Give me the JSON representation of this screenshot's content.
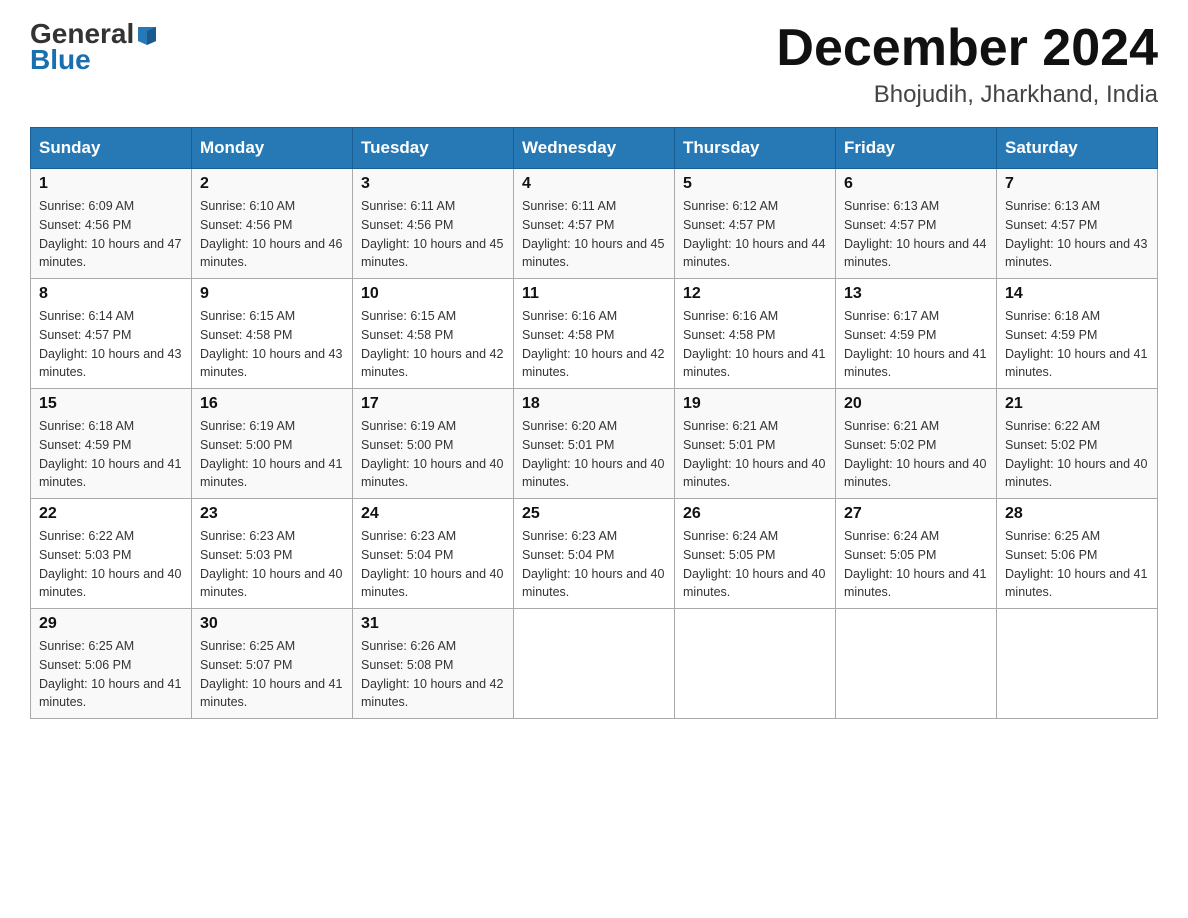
{
  "header": {
    "logo_general": "General",
    "logo_blue": "Blue",
    "month_title": "December 2024",
    "location": "Bhojudih, Jharkhand, India"
  },
  "days_of_week": [
    "Sunday",
    "Monday",
    "Tuesday",
    "Wednesday",
    "Thursday",
    "Friday",
    "Saturday"
  ],
  "weeks": [
    [
      {
        "day": "1",
        "sunrise": "6:09 AM",
        "sunset": "4:56 PM",
        "daylight": "10 hours and 47 minutes."
      },
      {
        "day": "2",
        "sunrise": "6:10 AM",
        "sunset": "4:56 PM",
        "daylight": "10 hours and 46 minutes."
      },
      {
        "day": "3",
        "sunrise": "6:11 AM",
        "sunset": "4:56 PM",
        "daylight": "10 hours and 45 minutes."
      },
      {
        "day": "4",
        "sunrise": "6:11 AM",
        "sunset": "4:57 PM",
        "daylight": "10 hours and 45 minutes."
      },
      {
        "day": "5",
        "sunrise": "6:12 AM",
        "sunset": "4:57 PM",
        "daylight": "10 hours and 44 minutes."
      },
      {
        "day": "6",
        "sunrise": "6:13 AM",
        "sunset": "4:57 PM",
        "daylight": "10 hours and 44 minutes."
      },
      {
        "day": "7",
        "sunrise": "6:13 AM",
        "sunset": "4:57 PM",
        "daylight": "10 hours and 43 minutes."
      }
    ],
    [
      {
        "day": "8",
        "sunrise": "6:14 AM",
        "sunset": "4:57 PM",
        "daylight": "10 hours and 43 minutes."
      },
      {
        "day": "9",
        "sunrise": "6:15 AM",
        "sunset": "4:58 PM",
        "daylight": "10 hours and 43 minutes."
      },
      {
        "day": "10",
        "sunrise": "6:15 AM",
        "sunset": "4:58 PM",
        "daylight": "10 hours and 42 minutes."
      },
      {
        "day": "11",
        "sunrise": "6:16 AM",
        "sunset": "4:58 PM",
        "daylight": "10 hours and 42 minutes."
      },
      {
        "day": "12",
        "sunrise": "6:16 AM",
        "sunset": "4:58 PM",
        "daylight": "10 hours and 41 minutes."
      },
      {
        "day": "13",
        "sunrise": "6:17 AM",
        "sunset": "4:59 PM",
        "daylight": "10 hours and 41 minutes."
      },
      {
        "day": "14",
        "sunrise": "6:18 AM",
        "sunset": "4:59 PM",
        "daylight": "10 hours and 41 minutes."
      }
    ],
    [
      {
        "day": "15",
        "sunrise": "6:18 AM",
        "sunset": "4:59 PM",
        "daylight": "10 hours and 41 minutes."
      },
      {
        "day": "16",
        "sunrise": "6:19 AM",
        "sunset": "5:00 PM",
        "daylight": "10 hours and 41 minutes."
      },
      {
        "day": "17",
        "sunrise": "6:19 AM",
        "sunset": "5:00 PM",
        "daylight": "10 hours and 40 minutes."
      },
      {
        "day": "18",
        "sunrise": "6:20 AM",
        "sunset": "5:01 PM",
        "daylight": "10 hours and 40 minutes."
      },
      {
        "day": "19",
        "sunrise": "6:21 AM",
        "sunset": "5:01 PM",
        "daylight": "10 hours and 40 minutes."
      },
      {
        "day": "20",
        "sunrise": "6:21 AM",
        "sunset": "5:02 PM",
        "daylight": "10 hours and 40 minutes."
      },
      {
        "day": "21",
        "sunrise": "6:22 AM",
        "sunset": "5:02 PM",
        "daylight": "10 hours and 40 minutes."
      }
    ],
    [
      {
        "day": "22",
        "sunrise": "6:22 AM",
        "sunset": "5:03 PM",
        "daylight": "10 hours and 40 minutes."
      },
      {
        "day": "23",
        "sunrise": "6:23 AM",
        "sunset": "5:03 PM",
        "daylight": "10 hours and 40 minutes."
      },
      {
        "day": "24",
        "sunrise": "6:23 AM",
        "sunset": "5:04 PM",
        "daylight": "10 hours and 40 minutes."
      },
      {
        "day": "25",
        "sunrise": "6:23 AM",
        "sunset": "5:04 PM",
        "daylight": "10 hours and 40 minutes."
      },
      {
        "day": "26",
        "sunrise": "6:24 AM",
        "sunset": "5:05 PM",
        "daylight": "10 hours and 40 minutes."
      },
      {
        "day": "27",
        "sunrise": "6:24 AM",
        "sunset": "5:05 PM",
        "daylight": "10 hours and 41 minutes."
      },
      {
        "day": "28",
        "sunrise": "6:25 AM",
        "sunset": "5:06 PM",
        "daylight": "10 hours and 41 minutes."
      }
    ],
    [
      {
        "day": "29",
        "sunrise": "6:25 AM",
        "sunset": "5:06 PM",
        "daylight": "10 hours and 41 minutes."
      },
      {
        "day": "30",
        "sunrise": "6:25 AM",
        "sunset": "5:07 PM",
        "daylight": "10 hours and 41 minutes."
      },
      {
        "day": "31",
        "sunrise": "6:26 AM",
        "sunset": "5:08 PM",
        "daylight": "10 hours and 42 minutes."
      },
      null,
      null,
      null,
      null
    ]
  ]
}
